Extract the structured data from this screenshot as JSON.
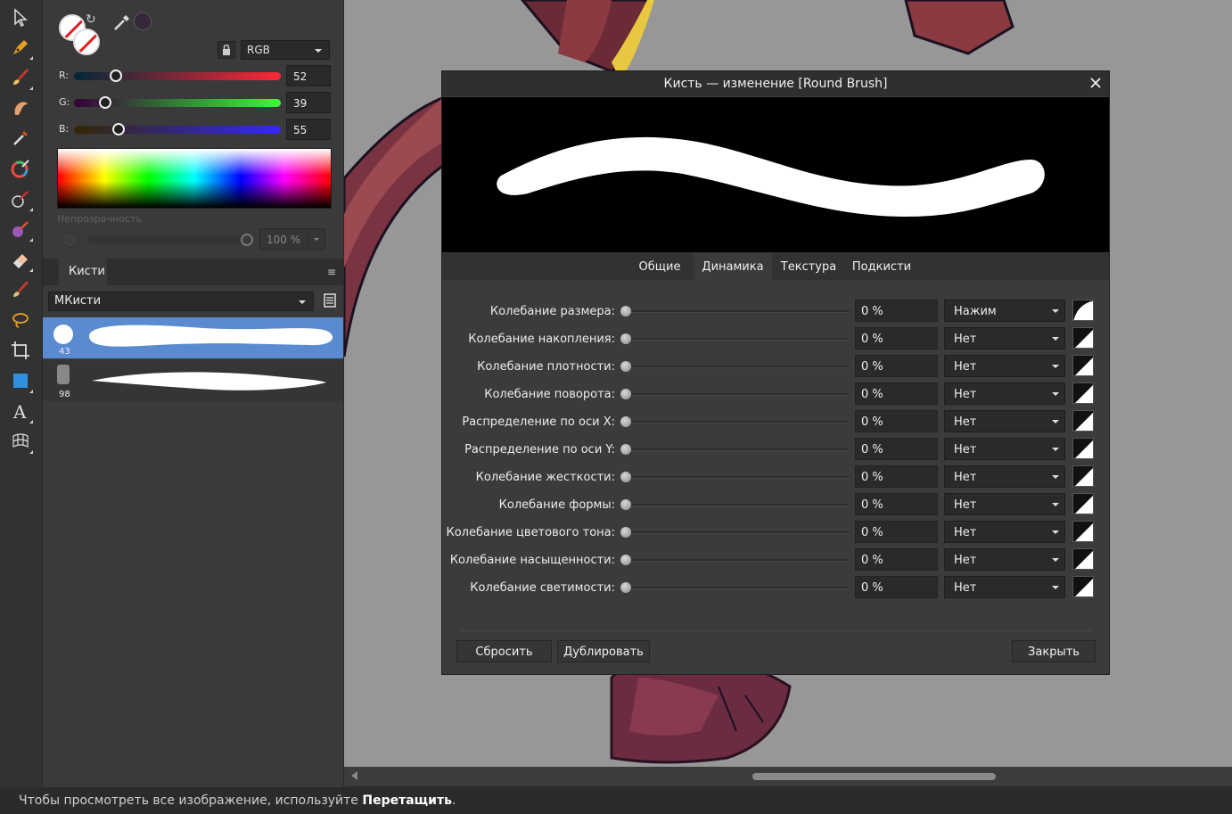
{
  "color_panel": {
    "mode": "RGB",
    "current_color": "#342737",
    "channels": [
      {
        "label": "R:",
        "value": "52",
        "fraction": 0.204
      },
      {
        "label": "G:",
        "value": "39",
        "fraction": 0.153
      },
      {
        "label": "B:",
        "value": "55",
        "fraction": 0.216
      }
    ],
    "opacity_label": "Непрозрачность",
    "opacity_value": "100 %"
  },
  "brushes_panel": {
    "tab_label": "Кисти",
    "category": "МКисти",
    "items": [
      {
        "size": "43",
        "selected": true
      },
      {
        "size": "98",
        "selected": false
      }
    ]
  },
  "dialog": {
    "title": "Кисть — изменение [Round Brush]",
    "tabs": [
      {
        "label": "Общие",
        "active": false
      },
      {
        "label": "Динамика",
        "active": true
      },
      {
        "label": "Текстура",
        "active": false
      },
      {
        "label": "Подкисти",
        "active": false
      }
    ],
    "rows": [
      {
        "label": "Колебание размера:",
        "value": "0 %",
        "controller": "Нажим"
      },
      {
        "label": "Колебание накопления:",
        "value": "0 %",
        "controller": "Нет"
      },
      {
        "label": "Колебание плотности:",
        "value": "0 %",
        "controller": "Нет"
      },
      {
        "label": "Колебание поворота:",
        "value": "0 %",
        "controller": "Нет"
      },
      {
        "label": "Распределение по оси X:",
        "value": "0 %",
        "controller": "Нет"
      },
      {
        "label": "Распределение по оси Y:",
        "value": "0 %",
        "controller": "Нет"
      },
      {
        "label": "Колебание жесткости:",
        "value": "0 %",
        "controller": "Нет"
      },
      {
        "label": "Колебание формы:",
        "value": "0 %",
        "controller": "Нет"
      },
      {
        "label": "Колебание цветового тона:",
        "value": "0 %",
        "controller": "Нет"
      },
      {
        "label": "Колебание насыщенности:",
        "value": "0 %",
        "controller": "Нет"
      },
      {
        "label": "Колебание светимости:",
        "value": "0 %",
        "controller": "Нет"
      }
    ],
    "buttons": {
      "reset": "Сбросить",
      "duplicate": "Дублировать",
      "close": "Закрыть"
    }
  },
  "status_bar": {
    "text": "Чтобы просмотреть все изображение, используйте ",
    "bold": "Перетащить",
    "suffix": "."
  },
  "tools": [
    "move-tool-icon",
    "pen-tool-icon",
    "paint-brush-icon",
    "smudge-icon",
    "color-picker-icon",
    "color-wheel-icon",
    "dodge-brush-icon",
    "pixel-brush-icon",
    "eraser-icon",
    "fill-brush-icon",
    "lasso-icon",
    "crop-icon",
    "rectangle-icon",
    "text-icon",
    "mesh-warp-icon"
  ]
}
